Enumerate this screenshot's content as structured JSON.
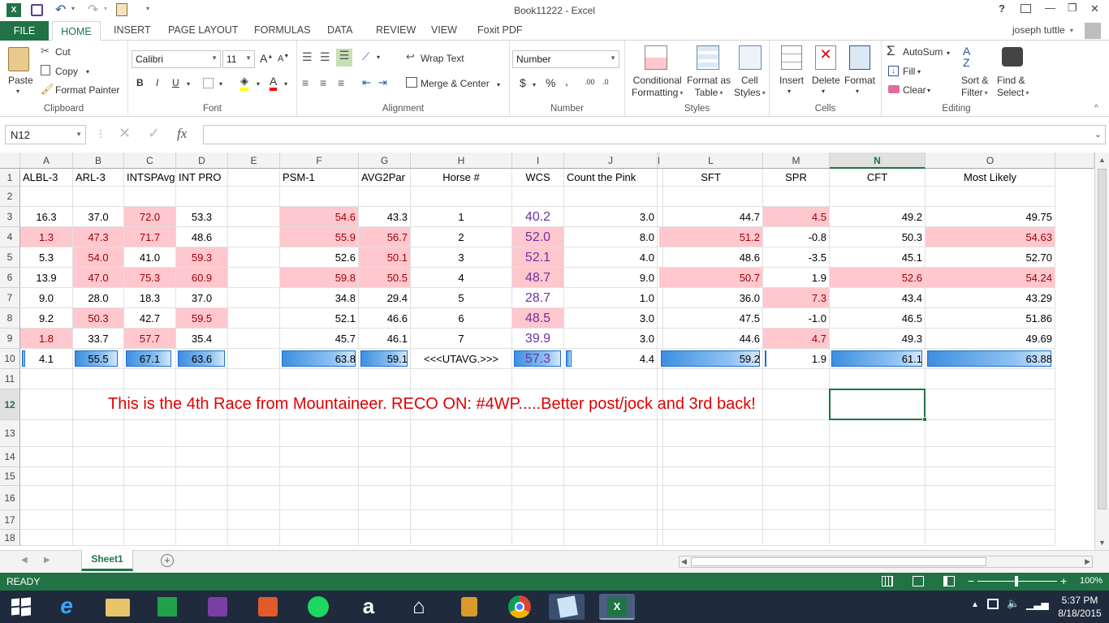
{
  "app": {
    "title": "Book11222 - Excel",
    "user": "joseph tuttle"
  },
  "qat": {
    "save": "save-icon",
    "undo": "undo-icon",
    "redo": "redo-icon"
  },
  "window": {
    "help": "?",
    "minimize": "—",
    "restore": "❐",
    "close": "✕"
  },
  "tabs": [
    "FILE",
    "HOME",
    "INSERT",
    "PAGE LAYOUT",
    "FORMULAS",
    "DATA",
    "REVIEW",
    "VIEW",
    "Foxit PDF"
  ],
  "active_tab": "HOME",
  "ribbon": {
    "clipboard": {
      "paste": "Paste",
      "cut": "Cut",
      "copy": "Copy",
      "format_painter": "Format Painter",
      "label": "Clipboard"
    },
    "font": {
      "name": "Calibri",
      "size": "11",
      "bold": "B",
      "italic": "I",
      "underline": "U",
      "label": "Font"
    },
    "alignment": {
      "wrap": "Wrap Text",
      "merge": "Merge & Center",
      "label": "Alignment"
    },
    "number": {
      "format": "Number",
      "label": "Number"
    },
    "styles": {
      "cond1": "Conditional",
      "cond2": "Formatting",
      "fmt1": "Format as",
      "fmt2": "Table",
      "cell1": "Cell",
      "cell2": "Styles",
      "label": "Styles"
    },
    "cells": {
      "insert": "Insert",
      "delete": "Delete",
      "format": "Format",
      "label": "Cells"
    },
    "editing": {
      "autosum": "AutoSum",
      "fill": "Fill",
      "clear": "Clear",
      "sort1": "Sort &",
      "sort2": "Filter",
      "find1": "Find &",
      "find2": "Select",
      "label": "Editing"
    }
  },
  "formula_bar": {
    "name_box": "N12",
    "fx": "fx",
    "value": ""
  },
  "columns": [
    "A",
    "B",
    "C",
    "D",
    "E",
    "F",
    "G",
    "H",
    "I",
    "J",
    "K",
    "L",
    "M",
    "N",
    "O"
  ],
  "selected_column": "N",
  "row_numbers": [
    "1",
    "2",
    "3",
    "4",
    "5",
    "6",
    "7",
    "8",
    "9",
    "10",
    "11",
    "12",
    "13",
    "14",
    "15",
    "16",
    "17",
    "18"
  ],
  "selected_row": "12",
  "headers": [
    "ALBL-3",
    "ARL-3",
    "INTSPAvg",
    "INT PRO",
    "",
    "PSM-1",
    "AVG2Par",
    "Horse #",
    "WCS",
    "Count the Pink",
    "",
    "SFT",
    "SPR",
    "CFT",
    "Most Likely"
  ],
  "rows": [
    [
      "16.3",
      "37.0",
      "72.0",
      "53.3",
      "",
      "54.6",
      "43.3",
      "1",
      "40.2",
      "3.0",
      "",
      "44.7",
      "4.5",
      "49.2",
      "49.75"
    ],
    [
      "1.3",
      "47.3",
      "71.7",
      "48.6",
      "",
      "55.9",
      "56.7",
      "2",
      "52.0",
      "8.0",
      "",
      "51.2",
      "-0.8",
      "50.3",
      "54.63"
    ],
    [
      "5.3",
      "54.0",
      "41.0",
      "59.3",
      "",
      "52.6",
      "50.1",
      "3",
      "52.1",
      "4.0",
      "",
      "48.6",
      "-3.5",
      "45.1",
      "52.70"
    ],
    [
      "13.9",
      "47.0",
      "75.3",
      "60.9",
      "",
      "59.8",
      "50.5",
      "4",
      "48.7",
      "9.0",
      "",
      "50.7",
      "1.9",
      "52.6",
      "54.24"
    ],
    [
      "9.0",
      "28.0",
      "18.3",
      "37.0",
      "",
      "34.8",
      "29.4",
      "5",
      "28.7",
      "1.0",
      "",
      "36.0",
      "7.3",
      "43.4",
      "43.29"
    ],
    [
      "9.2",
      "50.3",
      "42.7",
      "59.5",
      "",
      "52.1",
      "46.6",
      "6",
      "48.5",
      "3.0",
      "",
      "47.5",
      "-1.0",
      "46.5",
      "51.86"
    ],
    [
      "1.8",
      "33.7",
      "57.7",
      "35.4",
      "",
      "45.7",
      "46.1",
      "7",
      "39.9",
      "3.0",
      "",
      "44.6",
      "4.7",
      "49.3",
      "49.69"
    ]
  ],
  "pink_map": [
    [
      0,
      0,
      1,
      0,
      0,
      1,
      0,
      0,
      0,
      0,
      0,
      0,
      1,
      0,
      0
    ],
    [
      1,
      1,
      1,
      0,
      0,
      1,
      1,
      0,
      1,
      0,
      0,
      1,
      0,
      0,
      1
    ],
    [
      0,
      1,
      0,
      1,
      0,
      0,
      1,
      0,
      1,
      0,
      0,
      0,
      0,
      0,
      0
    ],
    [
      0,
      1,
      1,
      1,
      0,
      1,
      1,
      0,
      1,
      0,
      0,
      1,
      0,
      1,
      1
    ],
    [
      0,
      0,
      0,
      0,
      0,
      0,
      0,
      0,
      0,
      0,
      0,
      0,
      1,
      0,
      0
    ],
    [
      0,
      1,
      0,
      1,
      0,
      0,
      0,
      0,
      1,
      0,
      0,
      0,
      0,
      0,
      0
    ],
    [
      1,
      0,
      1,
      0,
      0,
      0,
      0,
      0,
      0,
      0,
      0,
      0,
      1,
      0,
      0
    ]
  ],
  "avg_row": [
    "4.1",
    "55.5",
    "67.1",
    "63.6",
    "",
    "63.8",
    "59.1",
    "<<<UTAVG.>>>",
    "57.3",
    "4.4",
    "",
    "59.2",
    "1.9",
    "61.1",
    "63.88"
  ],
  "avg_bar_fraction": [
    0.06,
    0.9,
    0.94,
    0.97,
    0,
    0.98,
    0.96,
    0,
    0.97,
    0.06,
    0,
    0.98,
    0.02,
    0.98,
    0.98
  ],
  "note": "This is the 4th Race from Mountaineer. RECO ON: #4WP.....Better post/jock and 3rd back!",
  "sheet_tab": "Sheet1",
  "status": {
    "text": "READY",
    "zoom": "100%"
  },
  "clock": {
    "time": "5:37 PM",
    "date": "8/18/2015"
  },
  "colors": {
    "excel_green": "#217346",
    "pink_fill": "#ffc7ce",
    "pink_text": "#9c0006",
    "note_red": "#e00000",
    "wcs_purple": "#7030a0"
  }
}
